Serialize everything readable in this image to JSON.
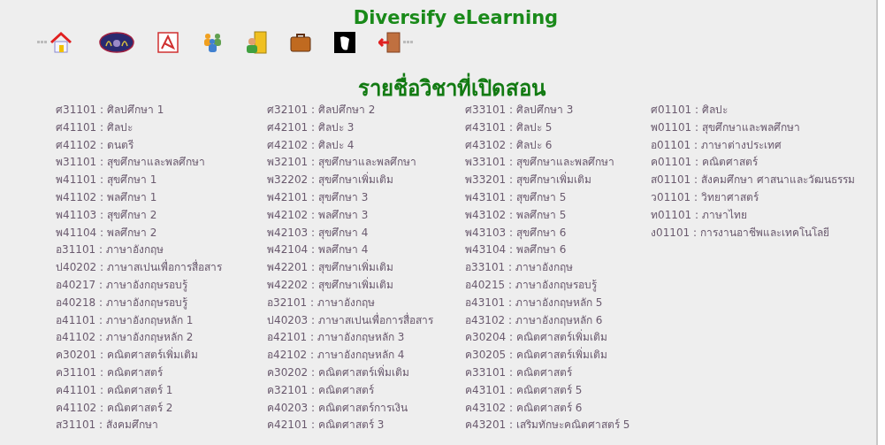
{
  "site_title": "Diversify eLearning",
  "toolbar": [
    {
      "kind": "home"
    },
    {
      "kind": "logo"
    },
    {
      "kind": "pdf"
    },
    {
      "kind": "people"
    },
    {
      "kind": "door-person"
    },
    {
      "kind": "briefcase"
    },
    {
      "kind": "mask"
    },
    {
      "kind": "exit"
    }
  ],
  "heading": "รายชื่อวิชาที่เปิดสอน",
  "columns": [
    [
      "ศ31101 : ศิลปศึกษา 1",
      "ศ41101 : ศิลปะ",
      "ศ41102 : ดนตรี",
      "พ31101 : สุขศึกษาและพลศึกษา",
      "พ41101 : สุขศึกษา 1",
      "พ41102 : พลศึกษา 1",
      "พ41103 : สุขศึกษา 2",
      "พ41104 : พลศึกษา 2",
      "อ31101 : ภาษาอังกฤษ",
      "ป40202 : ภาษาสเปนเพื่อการสื่อสาร",
      "อ40217 : ภาษาอังกฤษรอบรู้",
      "อ40218 : ภาษาอังกฤษรอบรู้",
      "อ41101 : ภาษาอังกฤษหลัก 1",
      "อ41102 : ภาษาอังกฤษหลัก 2",
      "ค30201 : คณิตศาสตร์เพิ่มเติม",
      "ค31101 : คณิตศาสตร์",
      "ค41101 : คณิตศาสตร์ 1",
      "ค41102 : คณิตศาสตร์ 2",
      "ส31101 : สังคมศึกษา"
    ],
    [
      "ศ32101 : ศิลปศึกษา 2",
      "ศ42101 : ศิลปะ 3",
      "ศ42102 : ศิลปะ 4",
      "พ32101 : สุขศึกษาและพลศึกษา",
      "พ32202 : สุขศึกษาเพิ่มเติม",
      "พ42101 : สุขศึกษา 3",
      "พ42102 : พลศึกษา 3",
      "พ42103 : สุขศึกษา 4",
      "พ42104 : พลศึกษา 4",
      "พ42201 : สุขศึกษาเพิ่มเติม",
      "พ42202 : สุขศึกษาเพิ่มเติม",
      "อ32101 : ภาษาอังกฤษ",
      "ป40203 : ภาษาสเปนเพื่อการสื่อสาร",
      "อ42101 : ภาษาอังกฤษหลัก 3",
      "อ42102 : ภาษาอังกฤษหลัก 4",
      "ค30202 : คณิตศาสตร์เพิ่มเติม",
      "ค32101 : คณิตศาสตร์",
      "ค40203 : คณิตศาสตร์การเงิน",
      "ค42101 : คณิตศาสตร์ 3"
    ],
    [
      "ศ33101 : ศิลปศึกษา 3",
      "ศ43101 : ศิลปะ 5",
      "ศ43102 : ศิลปะ 6",
      "พ33101 : สุขศึกษาและพลศึกษา",
      "พ33201 : สุขศึกษาเพิ่มเติม",
      "พ43101 : สุขศึกษา 5",
      "พ43102 : พลศึกษา 5",
      "พ43103 : สุขศึกษา 6",
      "พ43104 : พลศึกษา 6",
      "อ33101 : ภาษาอังกฤษ",
      "อ40215 : ภาษาอังกฤษรอบรู้",
      "อ43101 : ภาษาอังกฤษหลัก 5",
      "อ43102 : ภาษาอังกฤษหลัก 6",
      "ค30204 : คณิตศาสตร์เพิ่มเติม",
      "ค30205 : คณิตศาสตร์เพิ่มเติม",
      "ค33101 : คณิตศาสตร์",
      "ค43101 : คณิตศาสตร์ 5",
      "ค43102 : คณิตศาสตร์ 6",
      "ค43201 : เสริมทักษะคณิตศาสตร์ 5"
    ],
    [
      "ศ01101 : ศิลปะ",
      "พ01101 : สุขศึกษาและพลศึกษา",
      "อ01101 : ภาษาต่างประเทศ",
      "ค01101 : คณิตศาสตร์",
      "ส01101 : สังคมศึกษา ศาสนาและวัฒนธรรม",
      "ว01101 : วิทยาศาสตร์",
      "ท01101 : ภาษาไทย",
      "ง01101 : การงานอาชีพและเทคโนโลยี"
    ]
  ]
}
